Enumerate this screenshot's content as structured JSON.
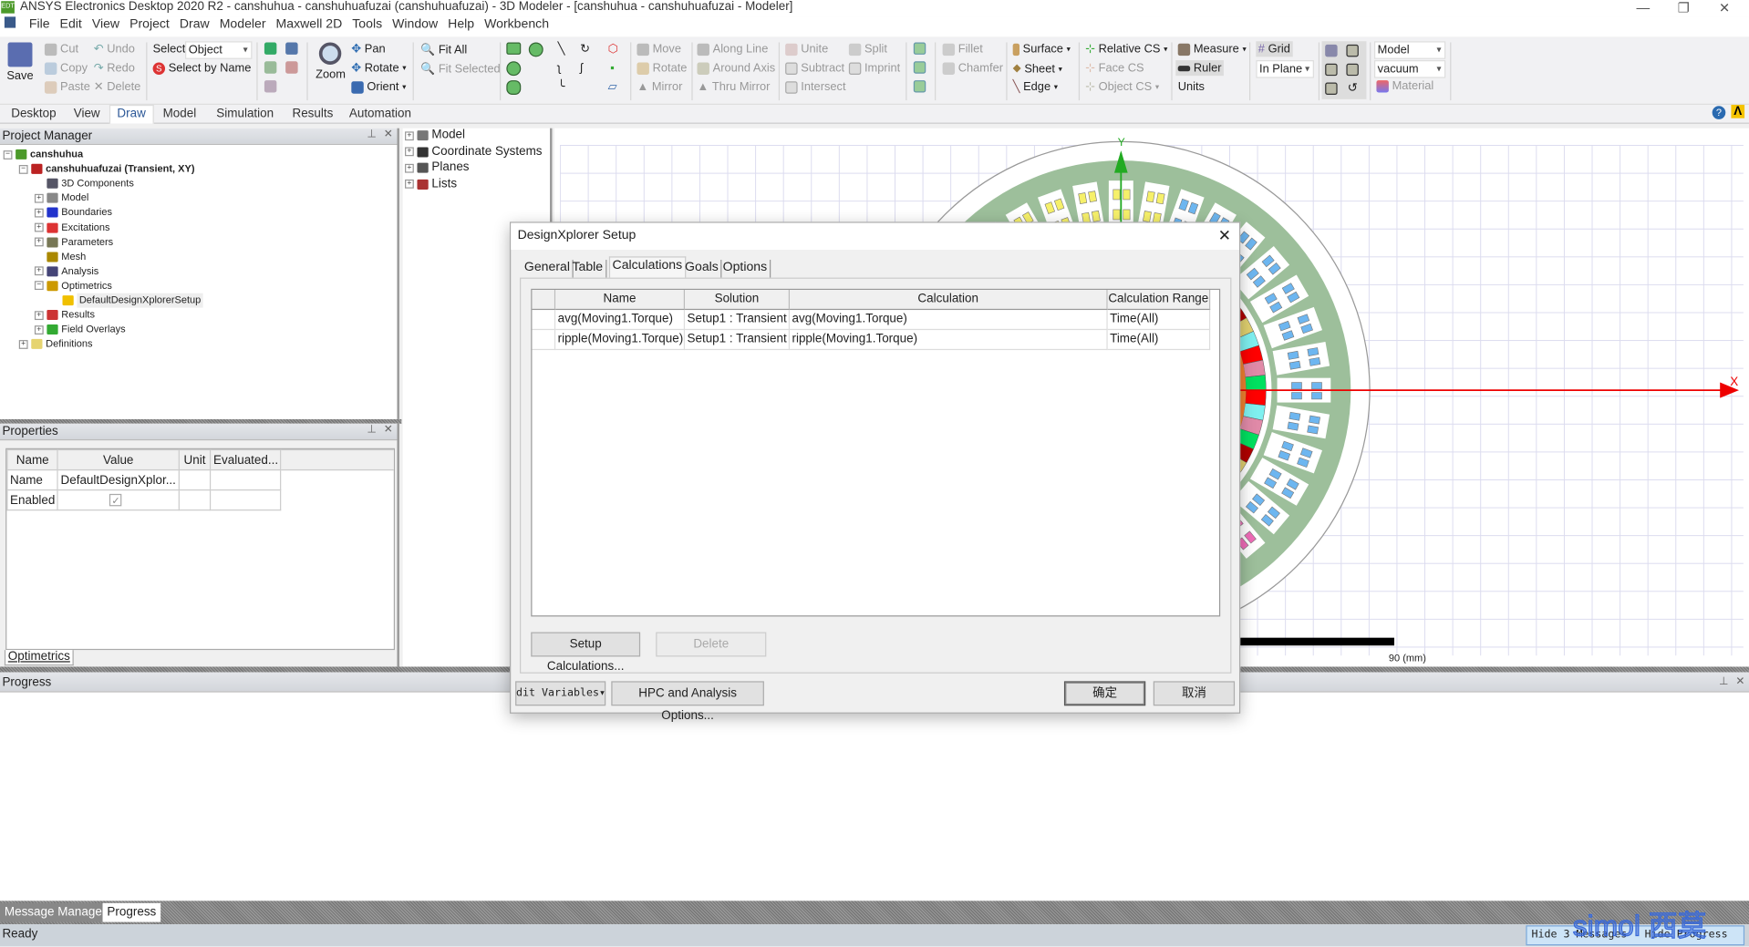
{
  "window": {
    "title": "ANSYS Electronics Desktop 2020 R2 - canshuhua - canshuhuafuzai (canshuhuafuzai) - 3D Modeler - [canshuhua - canshuhuafuzai - Modeler]",
    "logo_text": "EDT",
    "minimize": "—",
    "restore": "❐",
    "close": "✕"
  },
  "menu": [
    "File",
    "Edit",
    "View",
    "Project",
    "Draw",
    "Modeler",
    "Maxwell 2D",
    "Tools",
    "Window",
    "Help",
    "Workbench"
  ],
  "toolbar": {
    "save": "Save",
    "cut": "Cut",
    "copy": "Copy",
    "paste": "Paste",
    "undo": "Undo",
    "redo": "Redo",
    "delete": "Delete",
    "select_label": "Select:",
    "select_value": "Object",
    "select_by_name": "Select by Name",
    "zoom": "Zoom",
    "pan": "Pan",
    "rotate": "Rotate",
    "orient": "Orient",
    "fit_all": "Fit All",
    "fit_selected": "Fit Selected",
    "move": "Move",
    "rotate2": "Rotate",
    "mirror": "Mirror",
    "along_line": "Along Line",
    "around_axis": "Around Axis",
    "thru_mirror": "Thru Mirror",
    "unite": "Unite",
    "subtract": "Subtract",
    "intersect": "Intersect",
    "split": "Split",
    "imprint": "Imprint",
    "fillet": "Fillet",
    "chamfer": "Chamfer",
    "surface": "Surface",
    "sheet": "Sheet",
    "edge": "Edge",
    "relative_cs": "Relative CS",
    "face_cs": "Face CS",
    "object_cs": "Object CS",
    "measure": "Measure",
    "ruler": "Ruler",
    "units": "Units",
    "grid": "Grid",
    "grid_plane": "In Plane",
    "model_combo": "Model",
    "material_combo": "vacuum",
    "material": "Material"
  },
  "ribbon_tabs": [
    {
      "label": "Desktop",
      "active": false
    },
    {
      "label": "View",
      "active": false
    },
    {
      "label": "Draw",
      "active": true
    },
    {
      "label": "Model",
      "active": false
    },
    {
      "label": "Simulation",
      "active": false
    },
    {
      "label": "Results",
      "active": false
    },
    {
      "label": "Automation",
      "active": false
    }
  ],
  "project_manager": {
    "title": "Project Manager",
    "tree": [
      {
        "label": "canshuhua",
        "bold": true,
        "color": "#4c9a2a"
      },
      {
        "label": "canshuhuafuzai (Transient, XY)",
        "bold": true,
        "color": "#b22"
      },
      {
        "label": "3D Components",
        "color": "#556"
      },
      {
        "label": "Model",
        "color": "#888"
      },
      {
        "label": "Boundaries",
        "color": "#2233cc"
      },
      {
        "label": "Excitations",
        "color": "#d33"
      },
      {
        "label": "Parameters",
        "color": "#775"
      },
      {
        "label": "Mesh",
        "color": "#aa8800"
      },
      {
        "label": "Analysis",
        "color": "#447"
      },
      {
        "label": "Optimetrics",
        "color": "#cc9900"
      },
      {
        "label": "DefaultDesignXplorerSetup",
        "color": "#f0c000"
      },
      {
        "label": "Results",
        "color": "#c33"
      },
      {
        "label": "Field Overlays",
        "color": "#3a3"
      },
      {
        "label": "Definitions",
        "color": "#e6d470"
      }
    ]
  },
  "properties": {
    "title": "Properties",
    "headers": [
      "Name",
      "Value",
      "Unit",
      "Evaluated..."
    ],
    "rows": [
      {
        "name": "Name",
        "value": "DefaultDesignXplor...",
        "unit": "",
        "evaluated": ""
      },
      {
        "name": "Enabled",
        "value": "✓",
        "checked": true,
        "unit": "",
        "evaluated": ""
      }
    ],
    "tab": "Optimetrics"
  },
  "model_tree": [
    "Model",
    "Coordinate Systems",
    "Planes",
    "Lists"
  ],
  "viewport": {
    "axis_x": "X",
    "axis_y": "Y",
    "scale_label": "90 (mm)"
  },
  "progress": {
    "title": "Progress"
  },
  "bottom_tabs": [
    "Message Manager",
    "Progress"
  ],
  "status": {
    "text": "Ready",
    "hide_messages": "Hide 3 Messages",
    "hide_progress": "Hide Progress",
    "watermark": "simol 西莫"
  },
  "dialog": {
    "title": "DesignXplorer Setup",
    "tabs": [
      {
        "label": "General",
        "active": false
      },
      {
        "label": "Table",
        "active": false
      },
      {
        "label": "Calculations",
        "active": true
      },
      {
        "label": "Goals",
        "active": false
      },
      {
        "label": "Options",
        "active": false
      }
    ],
    "columns": [
      "Name",
      "Solution",
      "Calculation",
      "Calculation Range"
    ],
    "rows": [
      [
        "avg(Moving1.Torque)",
        "Setup1 : Transient",
        "avg(Moving1.Torque)",
        "Time(All)"
      ],
      [
        "ripple(Moving1.Torque)",
        "Setup1 : Transient",
        "ripple(Moving1.Torque)",
        "Time(All)"
      ]
    ],
    "setup_calculations": "Setup Calculations...",
    "delete": "Delete",
    "edit_variables": "Edit Variables",
    "hpc_options": "HPC and Analysis Options...",
    "ok": "确定",
    "cancel": "取消"
  }
}
